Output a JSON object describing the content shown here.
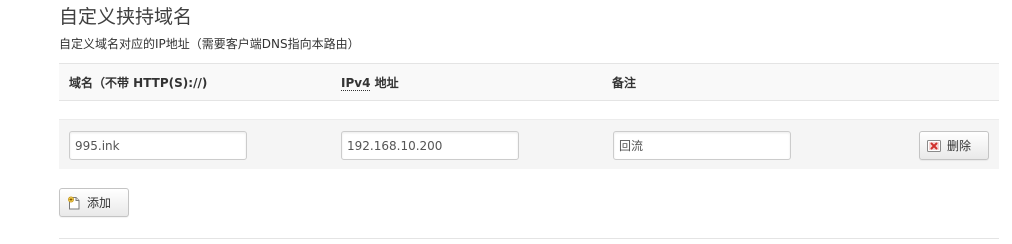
{
  "section": {
    "title": "自定义挟持域名",
    "description": "自定义域名对应的IP地址（需要客户端DNS指向本路由）"
  },
  "table": {
    "headers": {
      "domain": "域名（不带 HTTP(S)://)",
      "ip_abbr": "IPv4",
      "ip_suffix": " 地址",
      "note": "备注"
    },
    "rows": [
      {
        "domain": "995.ink",
        "ip": "192.168.10.200",
        "note": "回流",
        "remove_label": "删除"
      }
    ]
  },
  "actions": {
    "add_label": "添加"
  },
  "icons": {
    "remove": "remove-icon",
    "add": "add-icon"
  },
  "colors": {
    "remove_icon": "#d0312d",
    "add_icon": "#e8c24a"
  }
}
